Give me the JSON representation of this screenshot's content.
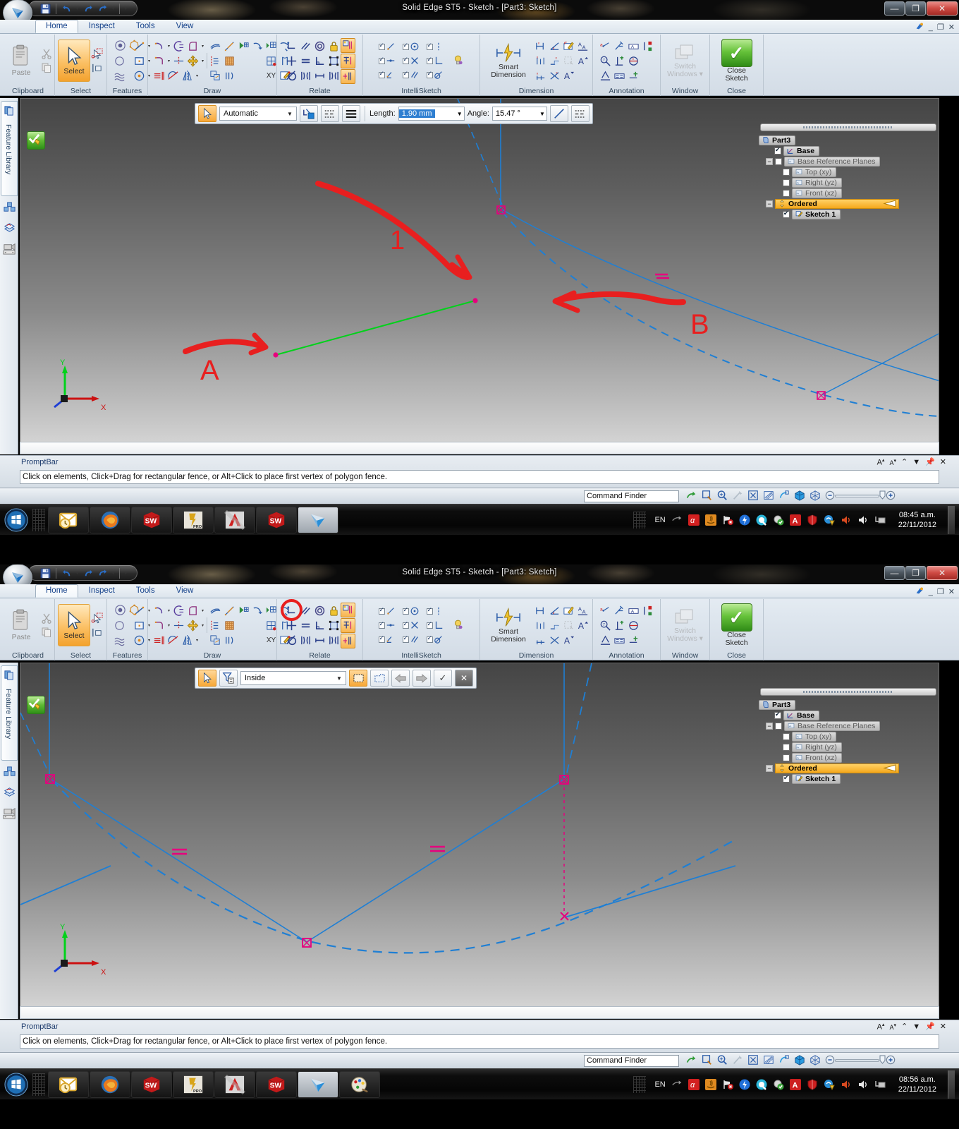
{
  "window_title": "Solid Edge ST5 - Sketch - [Part3: Sketch]",
  "tabs": [
    {
      "label": "Home",
      "active": true
    },
    {
      "label": "Inspect",
      "active": false
    },
    {
      "label": "Tools",
      "active": false
    },
    {
      "label": "View",
      "active": false
    }
  ],
  "ribbon_groups": [
    {
      "label": "Clipboard",
      "items": [
        "Paste",
        "Cut",
        "Copy"
      ]
    },
    {
      "label": "Select",
      "items": [
        "Select",
        "Select Similar",
        "Select Region"
      ]
    },
    {
      "label": "Features",
      "items": [
        "Region",
        "Contour",
        "Pattern"
      ]
    },
    {
      "label": "Draw",
      "items": [
        "Line",
        "Arc",
        "Circle",
        "Curve",
        "Fillet",
        "Rectangle",
        "Trim",
        "Mirror"
      ]
    },
    {
      "label": "Relate",
      "items": [
        "Connect",
        "Parallel",
        "Concentric",
        "Lock",
        "Maintain Relationships",
        "Horizontal/Vertical",
        "Equal",
        "Perpendicular",
        "Relationship Assistant",
        "Tangent",
        "Symmetric",
        "Collinear",
        "Relationship Colors"
      ]
    },
    {
      "label": "IntelliSketch",
      "items": [
        "Point on Element",
        "Midpoint",
        "Endpoint",
        "Center Point",
        "Intersection",
        "Silhouette",
        "Tangent",
        "Parallel",
        "Perpendicular"
      ]
    },
    {
      "label": "Dimension",
      "items": [
        "Smart Dimension",
        "Distance Between",
        "Angle Between",
        "Symmetric Diameter",
        "Coordinate Dimension",
        "Dimension Axis",
        "Edit Dimension Style"
      ]
    },
    {
      "label": "Annotation",
      "items": [
        "Leader",
        "Balloon",
        "Feature Callout",
        "Callout",
        "Inspection",
        "Surface Texture",
        "Weld Symbol",
        "Datum Frame",
        "Edge Condition",
        "Center Mark"
      ]
    },
    {
      "label": "Window",
      "items": [
        "Switch Windows"
      ]
    },
    {
      "label": "Close",
      "items": [
        "Close Sketch"
      ]
    }
  ],
  "ribbon_buttons": {
    "paste": "Paste",
    "select": "Select",
    "smart_dimension_line1": "Smart",
    "smart_dimension_line2": "Dimension",
    "switch_windows_line1": "Switch",
    "switch_windows_line2": "Windows",
    "close_sketch_line1": "Close",
    "close_sketch_line2": "Sketch"
  },
  "window1": {
    "command_bar": {
      "mode_select": "Automatic",
      "length_label": "Length:",
      "length_value": "1.90 mm",
      "angle_label": "Angle:",
      "angle_value": "15.47 °"
    },
    "annotations": [
      {
        "name": "callout-1",
        "label": "1"
      },
      {
        "name": "callout-A",
        "label": "A"
      },
      {
        "name": "callout-B",
        "label": "B"
      }
    ],
    "axis": {
      "x": "X",
      "y": "Y"
    },
    "clock_time": "08:45 a.m.",
    "clock_date": "22/11/2012"
  },
  "window2": {
    "command_bar": {
      "fence_select": "Inside",
      "accept": "✓",
      "cancel": "✕"
    },
    "axis": {
      "x": "X",
      "y": "Y"
    },
    "clock_time": "08:56 a.m.",
    "clock_date": "22/11/2012"
  },
  "tree": {
    "root": "Part3",
    "items": [
      {
        "label": "Base",
        "checked": true,
        "indent": 1,
        "dim": false,
        "expander": false
      },
      {
        "label": "Base Reference Planes",
        "checked": false,
        "indent": 1,
        "dim": true,
        "expander": true
      },
      {
        "label": "Top (xy)",
        "checked": false,
        "indent": 2,
        "dim": true,
        "expander": false
      },
      {
        "label": "Right (yz)",
        "checked": false,
        "indent": 2,
        "dim": true,
        "expander": false
      },
      {
        "label": "Front (xz)",
        "checked": false,
        "indent": 2,
        "dim": true,
        "expander": false
      }
    ],
    "ordered_label": "Ordered",
    "sketch_label": "Sketch 1",
    "sketch_checked": true
  },
  "prompt": {
    "title": "PromptBar",
    "message": "Click on elements, Click+Drag for rectangular fence, or Alt+Click to place first vertex of polygon fence."
  },
  "status": {
    "command_finder_placeholder": "Command Finder"
  },
  "dock": {
    "feature_library": "Feature Library"
  },
  "taskbar": {
    "language": "EN",
    "items": [
      "start-orb",
      "outlook-icon",
      "firefox-icon",
      "solidworks-icon",
      "inventor-icon",
      "autocad-icon",
      "solidworks-2-icon",
      "solidedge-icon",
      "paint-icon"
    ]
  },
  "colors": {
    "accent_orange": "#f5a81c",
    "sketch_blue": "#1f7fd4",
    "annotation_red": "#e81f1f",
    "selected_green": "#00d21a",
    "handle_magenta": "#e6007e",
    "title_dark": "#0b0b0b"
  }
}
